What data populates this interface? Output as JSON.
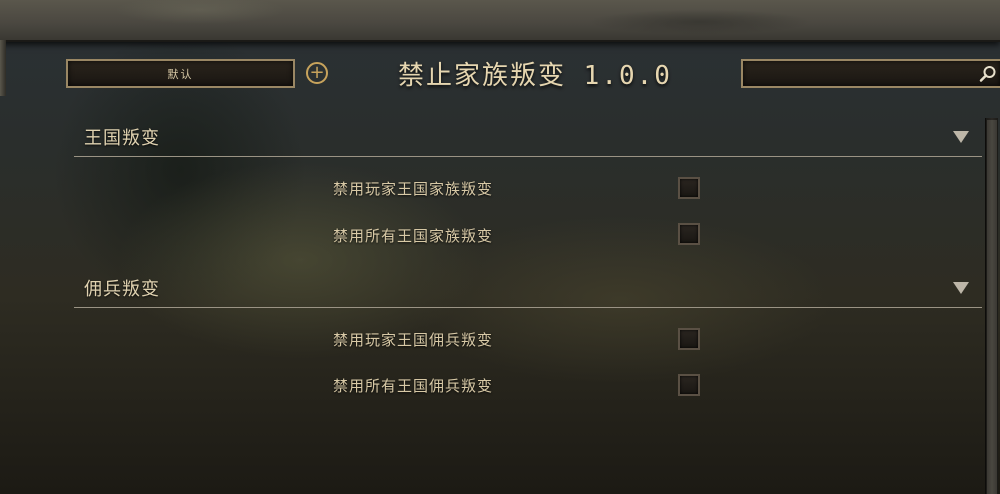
{
  "header": {
    "default_button_label": "默认",
    "add_button_label": "+",
    "title": "禁止家族叛变 1.0.0",
    "search_value": ""
  },
  "groups": [
    {
      "title": "王国叛变",
      "options": [
        {
          "label": "禁用玩家王国家族叛变",
          "checked": false
        },
        {
          "label": "禁用所有王国家族叛变",
          "checked": false
        }
      ]
    },
    {
      "title": "佣兵叛变",
      "options": [
        {
          "label": "禁用玩家王国佣兵叛变",
          "checked": false
        },
        {
          "label": "禁用所有王国佣兵叛变",
          "checked": false
        }
      ]
    }
  ],
  "icons": {
    "add": "plus-circle-icon",
    "search": "search-icon",
    "collapse": "triangle-down-icon"
  },
  "colors": {
    "accent_gold": "#c7a35c",
    "text": "#e0d2b0",
    "divider": "#9a9384"
  }
}
